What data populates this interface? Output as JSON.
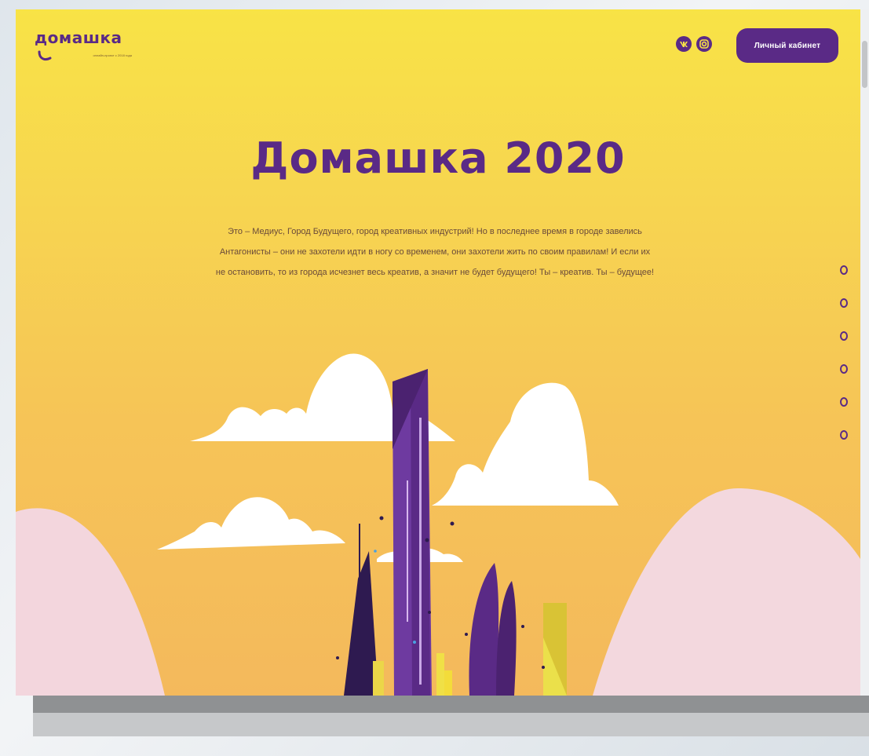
{
  "header": {
    "logo_text": "домашка",
    "logo_tagline": "онлайн-проект с 2018 года",
    "social": [
      "vk-icon",
      "instagram-icon"
    ],
    "cabinet_label": "Личный кабинет"
  },
  "hero": {
    "title": "Домашка 2020",
    "text": "Это – Медиус, Город Будущего, город креативных индустрий! Но в последнее время в городе завелись Антагонисты – они не захотели идти в ногу со временем, они захотели жить по своим правилам! И если их не остановить, то из города исчезнет весь креатив, а значит не будет будущего! Ты – креатив. Ты – будущее!"
  },
  "navigation_dots_count": 6,
  "colors": {
    "brand_purple": "#5a2a86",
    "bg_yellow": "#f8e346",
    "bg_orange": "#f4b95c",
    "hill_pink": "#f3d6dd"
  }
}
